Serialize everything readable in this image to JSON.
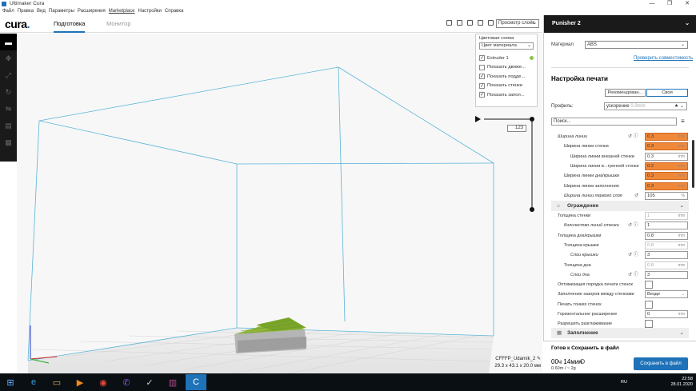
{
  "window": {
    "title": "Ultimaker Cura",
    "min": "—",
    "max": "❐",
    "close": "✕"
  },
  "menu": [
    "Файл",
    "Правка",
    "Вид",
    "Параметры",
    "Расширения",
    "Marketplace",
    "Настройки",
    "Справка"
  ],
  "header": {
    "logo": "cura",
    "logo_dot": ".",
    "tab_prepare": "Подготовка",
    "tab_monitor": "Монитор",
    "view_select": "Просмотр слоёв"
  },
  "color_panel": {
    "title": "Цветовая схема",
    "scheme": "Цвет материала",
    "extruder": "Extruder 1",
    "options": [
      {
        "label": "Показать движе...",
        "checked": false
      },
      {
        "label": "Показать подде...",
        "checked": true
      },
      {
        "label": "Показать стенки",
        "checked": true
      },
      {
        "label": "Показать запол...",
        "checked": true
      }
    ]
  },
  "layer": {
    "value": "123"
  },
  "model": {
    "name": "CFFFP_Udarnik_2",
    "dims": "29.3 x 43.1 x 20.0 мм"
  },
  "printer": {
    "name": "Punisher 2"
  },
  "material": {
    "label": "Материал",
    "value": "ABS",
    "check_link": "Проверить совместимость"
  },
  "print_settings": {
    "title": "Настройка печати",
    "mode_recommended": "Рекомендован...",
    "mode_custom": "Своя",
    "profile_label": "Профиль:",
    "profile_value": "ускорение",
    "profile_sub": "0.3mm",
    "search_placeholder": "Поиск..."
  },
  "settings": [
    {
      "label": "Ширина линии",
      "value": "0.3",
      "unit": "mm",
      "style": "orange",
      "indent": 8,
      "italic": true,
      "icons": "↺ ⓘ"
    },
    {
      "label": "Ширина линии стенки",
      "value": "0.3",
      "unit": "mm",
      "style": "orange",
      "indent": 16,
      "icons": ""
    },
    {
      "label": "Ширина линии внешней стенки",
      "value": "0.3",
      "unit": "mm",
      "style": "normal",
      "indent": 24,
      "icons": ""
    },
    {
      "label": "Ширина линии в...тренней стенки",
      "value": "0.2",
      "unit": "mm",
      "style": "orange",
      "indent": 24,
      "icons": ""
    },
    {
      "label": "Ширина линии дна/крышки",
      "value": "0.3",
      "unit": "mm",
      "style": "orange",
      "indent": 16,
      "icons": ""
    },
    {
      "label": "Ширина линии заполнения",
      "value": "0.3",
      "unit": "mm",
      "style": "orange",
      "indent": 16,
      "icons": ""
    },
    {
      "label": "Ширина линии первого слоя",
      "value": "105",
      "unit": "%",
      "style": "normal",
      "indent": 16,
      "italic": true,
      "icons": "↺"
    }
  ],
  "category_shell": {
    "label": "Ограждение"
  },
  "shell_settings": [
    {
      "label": "Толщина стенки",
      "value": "1",
      "unit": "mm",
      "style": "dis",
      "indent": 8,
      "icons": ""
    },
    {
      "label": "Количество линий стенки",
      "value": "1",
      "unit": "",
      "style": "normal",
      "indent": 16,
      "italic": true,
      "icons": "↺ ⓘ"
    },
    {
      "label": "Толщина дна/крышки",
      "value": "0.8",
      "unit": "mm",
      "style": "normal",
      "indent": 8,
      "icons": ""
    },
    {
      "label": "Толщина крышки",
      "value": "0.8",
      "unit": "mm",
      "style": "dis",
      "indent": 16,
      "icons": ""
    },
    {
      "label": "Слои крышки",
      "value": "3",
      "unit": "",
      "style": "normal",
      "indent": 24,
      "italic": true,
      "icons": "↺ ⓘ"
    },
    {
      "label": "Толщина дна",
      "value": "0.8",
      "unit": "mm",
      "style": "dis",
      "indent": 16,
      "icons": ""
    },
    {
      "label": "Слои дна",
      "value": "3",
      "unit": "",
      "style": "normal",
      "indent": 24,
      "italic": true,
      "icons": "↺ ⓘ"
    }
  ],
  "misc_settings": [
    {
      "label": "Оптимизация порядка печати стенок",
      "type": "check"
    },
    {
      "label": "Заполнение зазоров между стенками",
      "type": "select",
      "value": "Везде"
    },
    {
      "label": "Печать тонких стенок",
      "type": "check"
    },
    {
      "label": "Горизонтальное расширение",
      "type": "input",
      "value": "0",
      "unit": "mm"
    },
    {
      "label": "Разрешить разглаживание",
      "type": "check"
    }
  ],
  "category_infill": {
    "label": "Заполнение"
  },
  "footer": {
    "ready": "Готов к Сохранить в файл",
    "time": "00ч 14мин",
    "material_use": "0.60m / ~ 2g",
    "save": "Сохранить в файл"
  },
  "taskbar": {
    "lang": "RU",
    "time": "22:58",
    "date": "28.01.2020"
  }
}
